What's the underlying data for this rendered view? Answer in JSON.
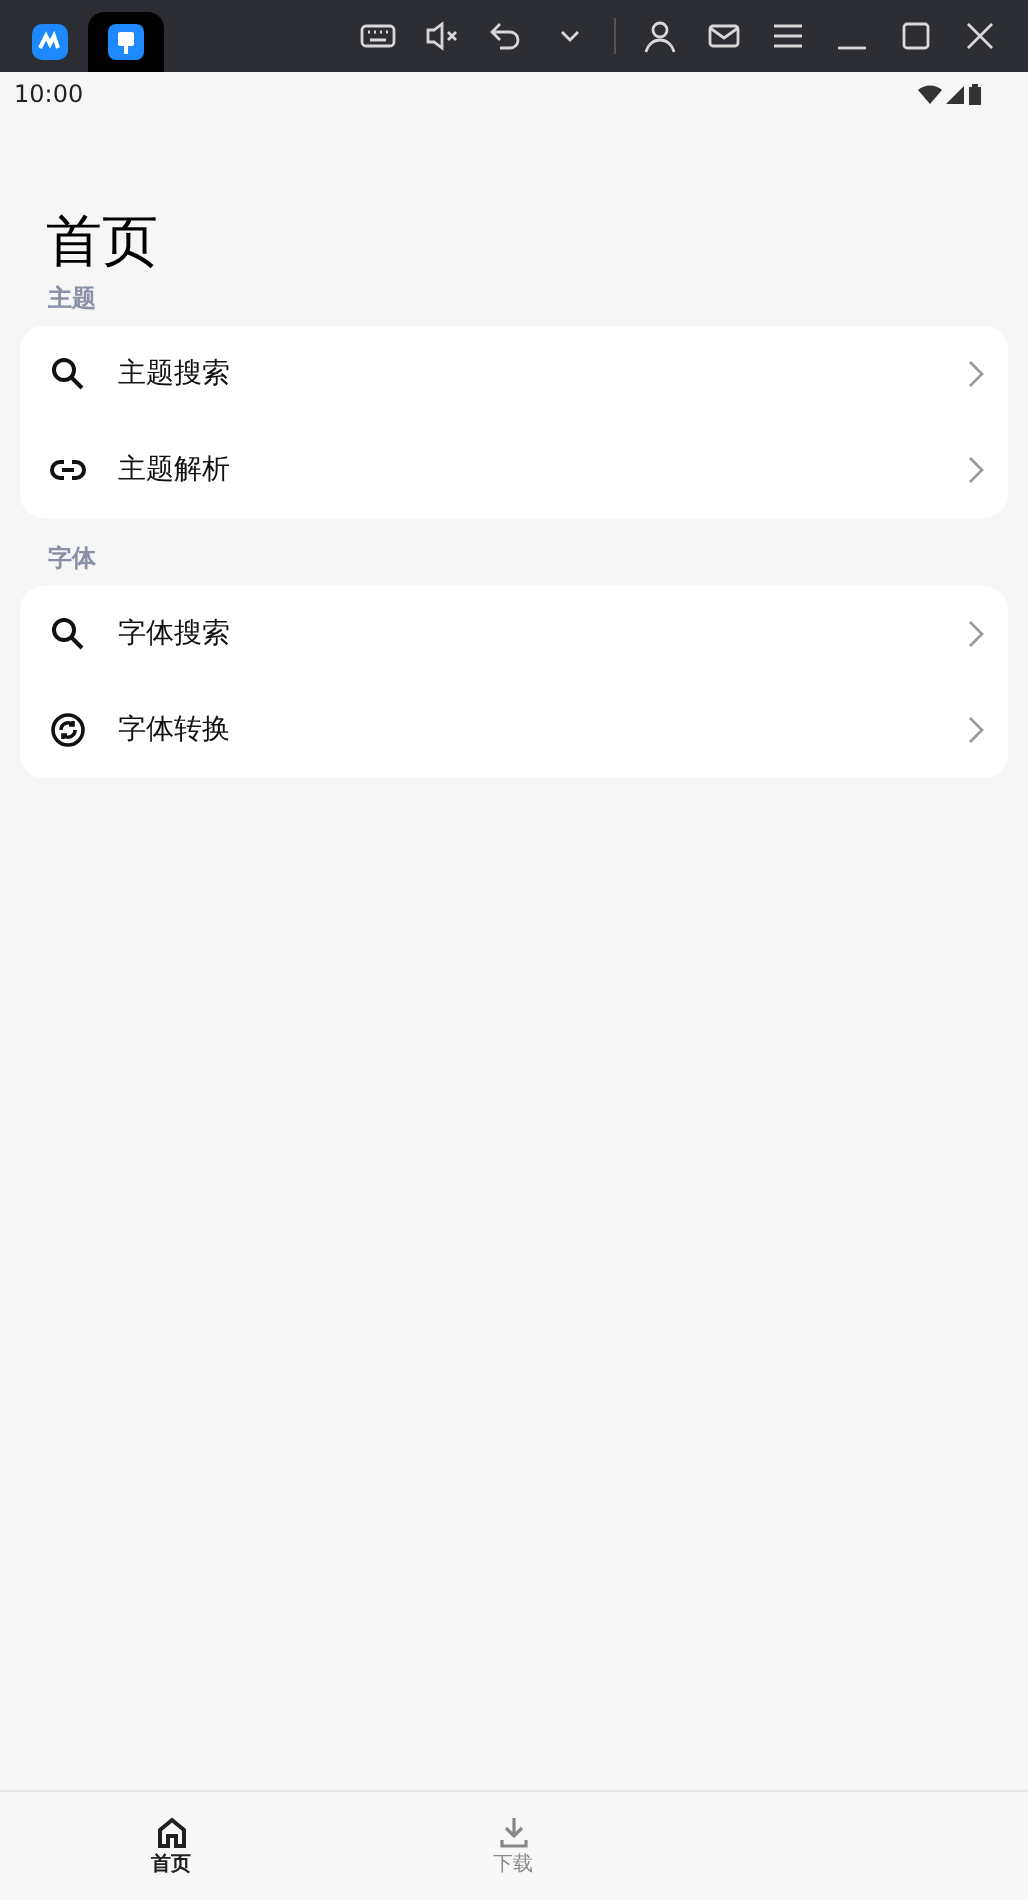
{
  "emulator_tabs": [
    {
      "selected": false
    },
    {
      "selected": true
    }
  ],
  "status_bar": {
    "time": "10:00"
  },
  "title": "首页",
  "sections": [
    {
      "label": "主题",
      "items": [
        {
          "kind": "search",
          "label": "主题搜索"
        },
        {
          "kind": "link",
          "label": "主题解析"
        }
      ]
    },
    {
      "label": "字体",
      "items": [
        {
          "kind": "search",
          "label": "字体搜索"
        },
        {
          "kind": "convert",
          "label": "字体转换"
        }
      ]
    }
  ],
  "bottom_nav": [
    {
      "kind": "home",
      "label": "首页",
      "selected": true
    },
    {
      "kind": "download",
      "label": "下载",
      "selected": false
    }
  ]
}
